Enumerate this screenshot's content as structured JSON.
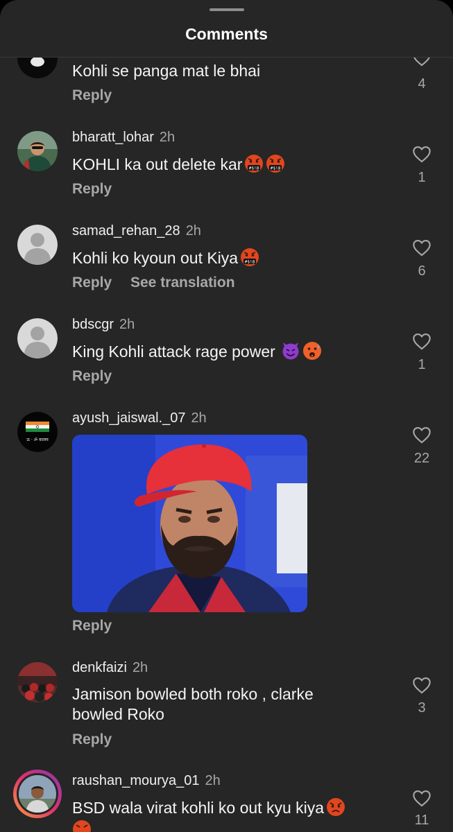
{
  "sheet": {
    "title": "Comments"
  },
  "labels": {
    "reply": "Reply",
    "see_translation": "See translation"
  },
  "comments": [
    {
      "username": "",
      "time": "",
      "text": "Kohli se panga mat le bhai",
      "likes": "4"
    },
    {
      "username": "bharatt_lohar",
      "time": "2h",
      "text": "KOHLI ka out delete kar",
      "likes": "1"
    },
    {
      "username": "samad_rehan_28",
      "time": "2h",
      "text": "Kohli ko kyoun out Kiya",
      "likes": "6"
    },
    {
      "username": "bdscgr",
      "time": "2h",
      "text": "King Kohli attack rage power",
      "likes": "1"
    },
    {
      "username": "ayush_jaiswal._07",
      "time": "2h",
      "text": "",
      "likes": "22",
      "avatar_caption": "ऊ · ॐ कालय"
    },
    {
      "username": "denkfaizi",
      "time": "2h",
      "text": "Jamison bowled both roko , clarke bowled Roko",
      "likes": "3"
    },
    {
      "username": "raushan_mourya_01",
      "time": "2h",
      "text": "BSD wala virat kohli ko out kyu kiya",
      "likes": "11"
    }
  ],
  "colors": {
    "background": "#262626",
    "secondary_text": "#a8a8a8",
    "story_ring": "#c13584"
  }
}
